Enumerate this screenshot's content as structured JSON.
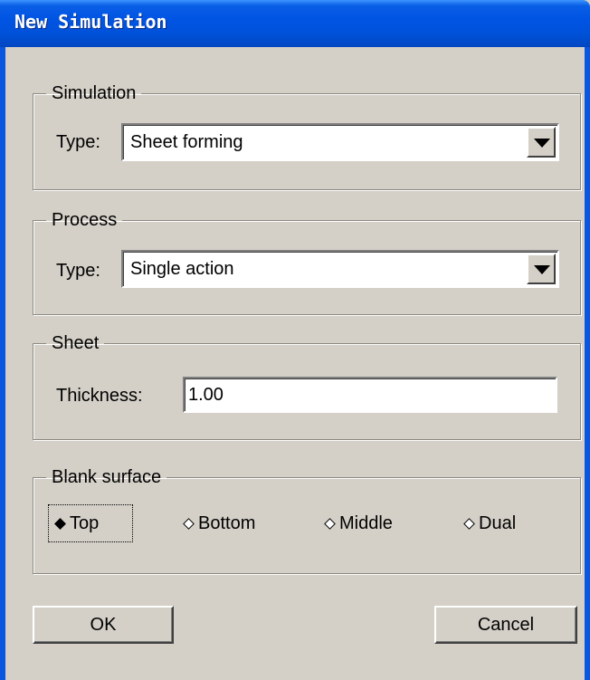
{
  "window": {
    "title": "New Simulation"
  },
  "simulation": {
    "group_label": "Simulation",
    "type_label": "Type:",
    "type_value": "Sheet forming"
  },
  "process": {
    "group_label": "Process",
    "type_label": "Type:",
    "type_value": "Single action"
  },
  "sheet": {
    "group_label": "Sheet",
    "thickness_label": "Thickness:",
    "thickness_value": "1.00"
  },
  "blank_surface": {
    "group_label": "Blank surface",
    "options": [
      {
        "label": "Top",
        "selected": true
      },
      {
        "label": "Bottom",
        "selected": false
      },
      {
        "label": "Middle",
        "selected": false
      },
      {
        "label": "Dual",
        "selected": false
      }
    ]
  },
  "buttons": {
    "ok": "OK",
    "cancel": "Cancel"
  },
  "colors": {
    "titlebar": "#0054e3",
    "dialog_bg": "#d4d0c8"
  },
  "icons": {
    "dropdown": "chevron-down-icon",
    "radio": "diamond-radio-icon"
  }
}
